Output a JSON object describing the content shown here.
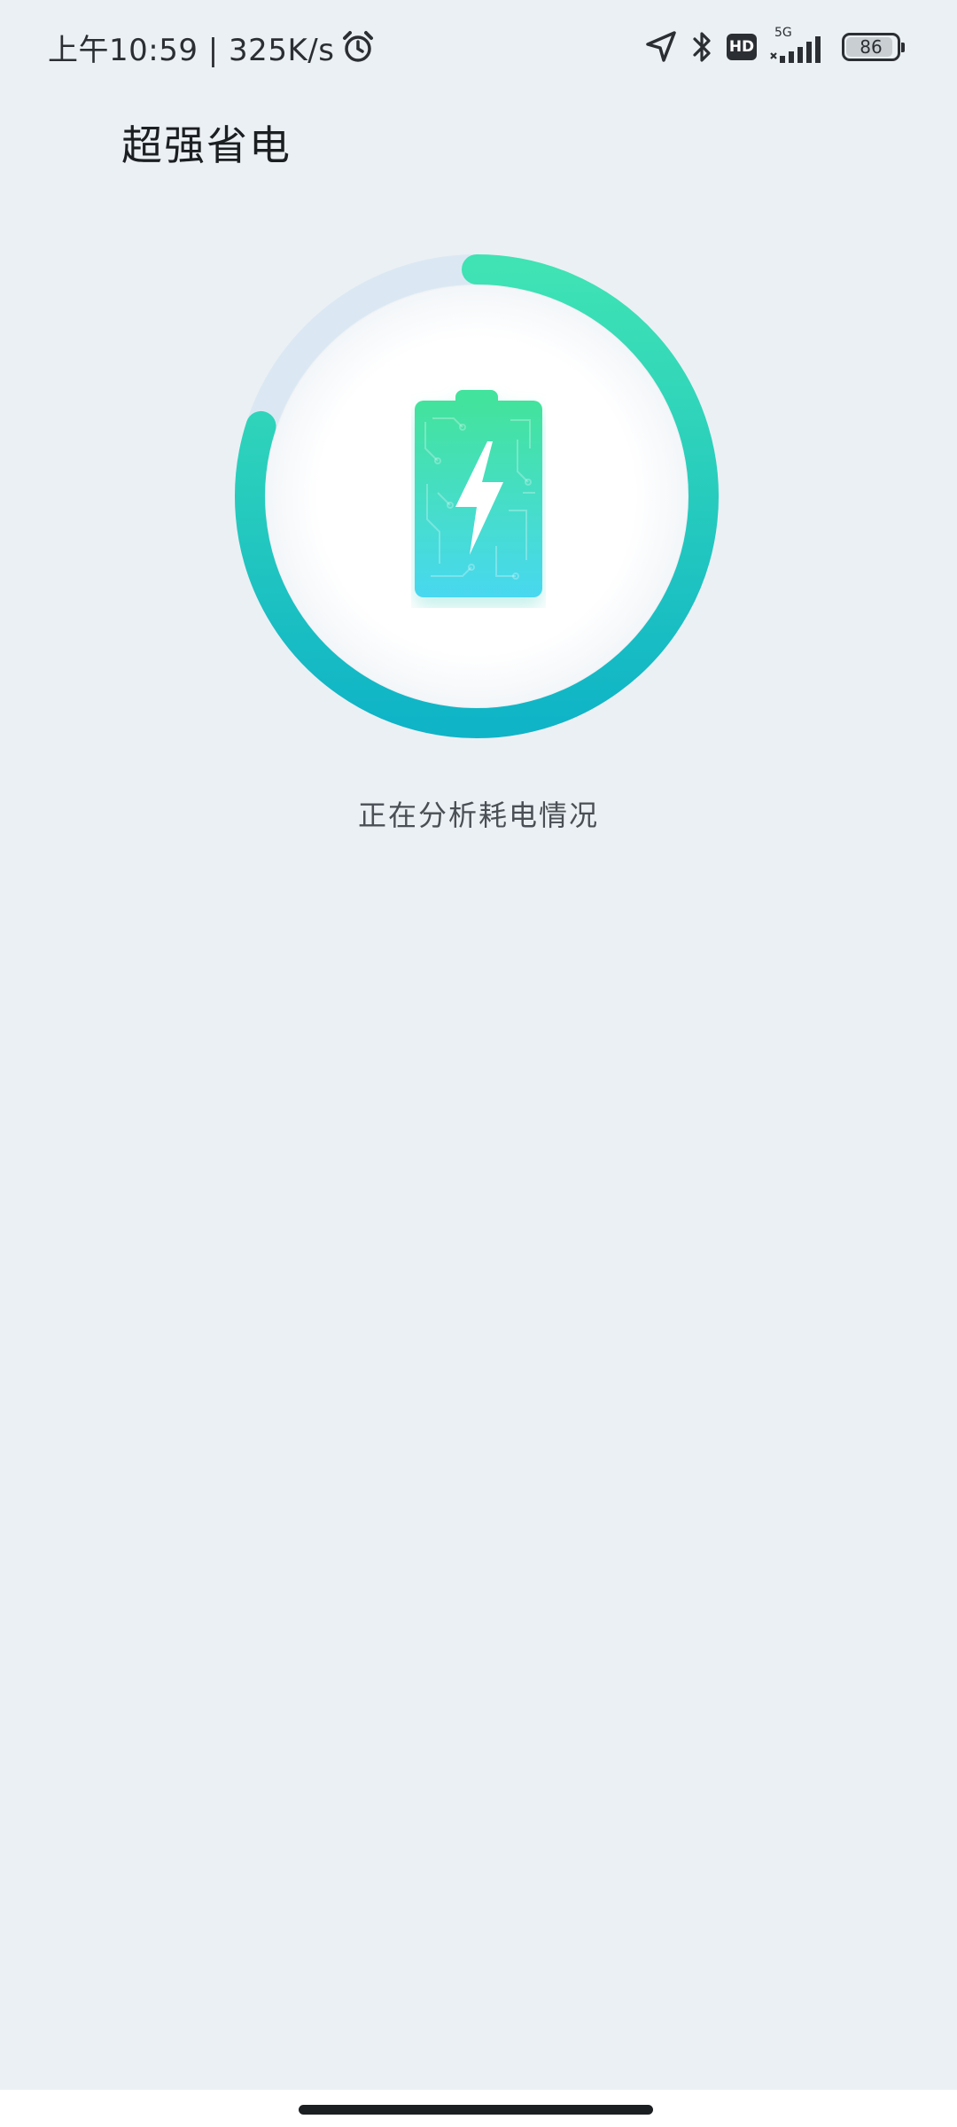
{
  "status_bar": {
    "time_text": "上午10:59 | 325K/s",
    "network_type": "5G",
    "hd_label": "HD",
    "battery_level": "86"
  },
  "page": {
    "title": "超强省电",
    "status_message": "正在分析耗电情况"
  },
  "progress": {
    "fraction": 0.8
  },
  "icons": {
    "alarm": "alarm-clock-icon",
    "location": "location-arrow-icon",
    "bluetooth": "bluetooth-icon",
    "signal": "cellular-signal-icon",
    "battery": "battery-icon",
    "hero": "battery-charging-icon"
  },
  "colors": {
    "ring_start": "#3fe3b4",
    "ring_end": "#0fb4c7",
    "ring_track": "#dbe8f3",
    "battery_top": "#43e39c",
    "battery_bottom": "#48d8f0"
  }
}
